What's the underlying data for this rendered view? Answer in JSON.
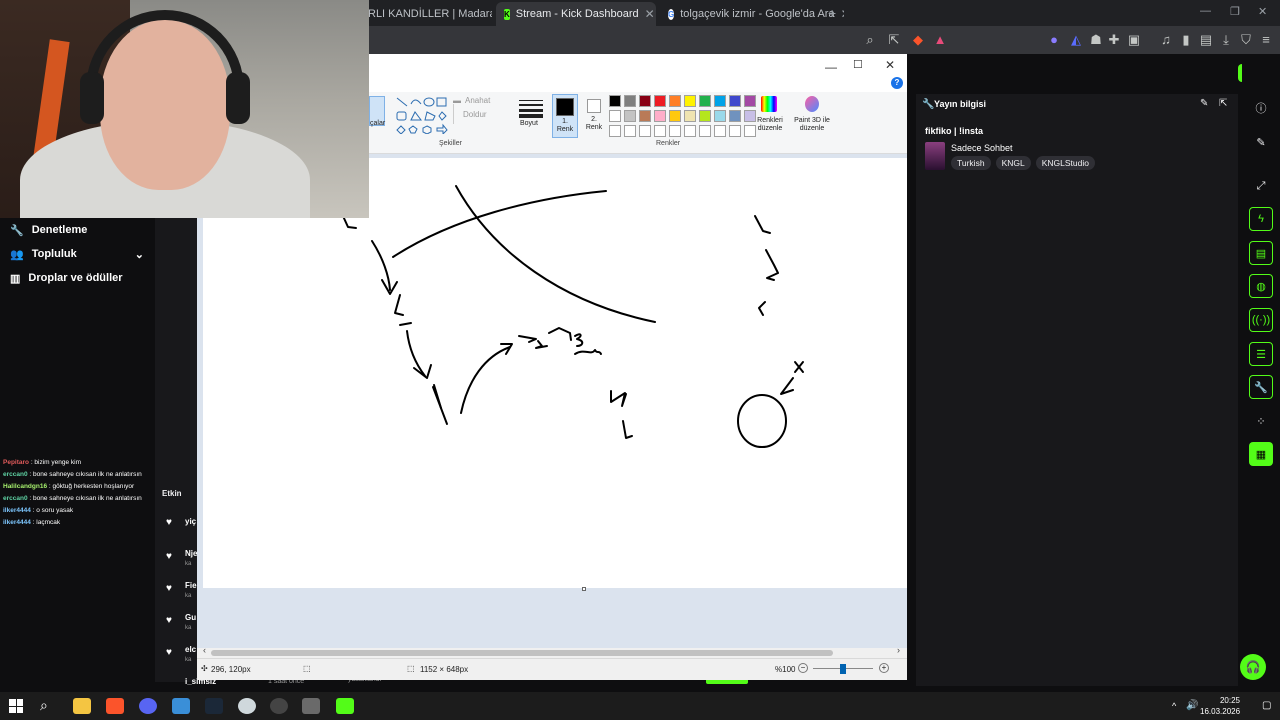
{
  "browser": {
    "tabs": [
      {
        "label": "RLI KANDİLLER | Madara Olduk"
      },
      {
        "label": "Stream - Kick Dashboard"
      },
      {
        "label": "tolgaçevik izmir - Google'da Ara"
      }
    ],
    "new_tab": "+"
  },
  "leftnav": {
    "items": [
      {
        "label": "Denetleme"
      },
      {
        "label": "Topluluk"
      },
      {
        "label": "Droplar ve ödüller"
      }
    ]
  },
  "chat": [
    {
      "user": "Pepitaro",
      "message": " : bizim yenge kim",
      "color": "#e05a5a"
    },
    {
      "user": "erccan0",
      "message": " : bone sahneye cıkısan ilk ne anlatırsın",
      "color": "#5fd3a4"
    },
    {
      "user": "Halilcandgn16",
      "message": " : göktuğ herkesten hoşlanıyor",
      "color": "#a6f06d"
    },
    {
      "user": "erccan0",
      "message": " : bone sahneye cıkısan ilk ne anlatırsın",
      "color": "#5fd3a4"
    },
    {
      "user": "ilker4444",
      "message": " : o soru yasak",
      "color": "#7dc7ff"
    },
    {
      "user": "ilker4444",
      "message": " : laçmcak",
      "color": "#7dc7ff"
    }
  ],
  "activity": {
    "header": "Etkin",
    "items": [
      "yiç",
      "Nje",
      "Fie",
      "Gu",
      "elc",
      "i_simsiz"
    ],
    "sub": "ka",
    "time": "1 saat önce",
    "bottom_note": "yasaklandı"
  },
  "paint": {
    "ribbon": {
      "tools_label": "çalar",
      "outline_label": "Anahat",
      "fill_label": "Doldur",
      "shapes_group": "Şekiller",
      "size_label": "Boyut",
      "color1_label": "1. Renk",
      "color2_label": "2. Renk",
      "colors_group": "Renkler",
      "edit_colors_label": "Renkleri düzenle",
      "paint3d_label": "Paint 3D ile düzenle"
    },
    "palette_row1": [
      "#000000",
      "#7f7f7f",
      "#880015",
      "#ed1c24",
      "#ff7f27",
      "#fff200",
      "#22b14c",
      "#00a2e8",
      "#3f48cc",
      "#a349a4"
    ],
    "palette_row2": [
      "#ffffff",
      "#c3c3c3",
      "#b97a57",
      "#ffaec9",
      "#ffc90e",
      "#efe4b0",
      "#b5e61d",
      "#99d9ea",
      "#7092be",
      "#c8bfe7"
    ],
    "status": {
      "cursor": "296, 120px",
      "size": "1152 × 648px",
      "zoom": "%100"
    }
  },
  "stream_info": {
    "title": "Yayın bilgisi",
    "stream_title": "fikfiko | !insta",
    "category": "Sadece Sohbet",
    "tags": [
      "Turkish",
      "KNGL",
      "KNGLStudio"
    ]
  },
  "taskbar": {
    "time": "20:25",
    "date": "16.03.2026"
  }
}
